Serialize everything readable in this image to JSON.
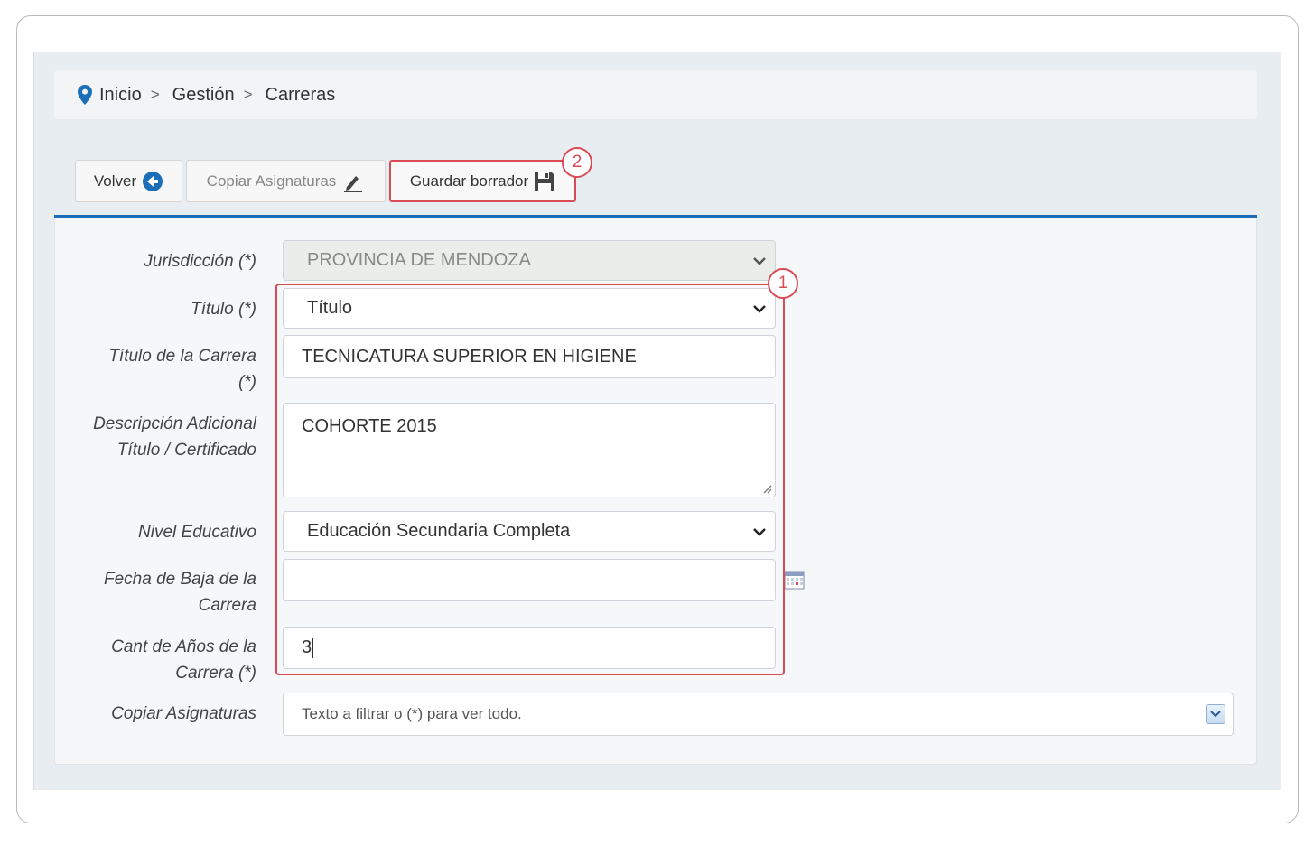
{
  "breadcrumb": {
    "items": [
      "Inicio",
      "Gestión",
      "Carreras"
    ],
    "separator": ">"
  },
  "toolbar": {
    "volver_label": "Volver",
    "copiar_label": "Copiar Asignaturas",
    "guardar_label": "Guardar borrador"
  },
  "annotations": {
    "badge_1": "1",
    "badge_2": "2",
    "highlight_color": "#d94b55"
  },
  "form": {
    "jurisdiccion": {
      "label": "Jurisdicción (*)",
      "value": "PROVINCIA DE MENDOZA"
    },
    "titulo": {
      "label": "Título (*)",
      "value": "Título"
    },
    "titulo_carrera": {
      "label_line1": "Título de la Carrera",
      "label_line2": "(*)",
      "value": "TECNICATURA SUPERIOR EN HIGIENE"
    },
    "descripcion": {
      "label_line1": "Descripción Adicional",
      "label_line2": "Título / Certificado",
      "value": "COHORTE 2015"
    },
    "nivel": {
      "label": "Nivel Educativo",
      "value": "Educación Secundaria Completa"
    },
    "fecha_baja": {
      "label_line1": "Fecha de Baja de la",
      "label_line2": "Carrera",
      "value": ""
    },
    "cant_anios": {
      "label_line1": "Cant de Años de la",
      "label_line2": "Carrera (*)",
      "value": "3"
    },
    "copiar_asignaturas": {
      "label": "Copiar Asignaturas",
      "placeholder": "Texto a filtrar o (*) para ver todo."
    }
  },
  "colors": {
    "accent_blue": "#1a6fb8",
    "highlight_red": "#d94b55"
  }
}
